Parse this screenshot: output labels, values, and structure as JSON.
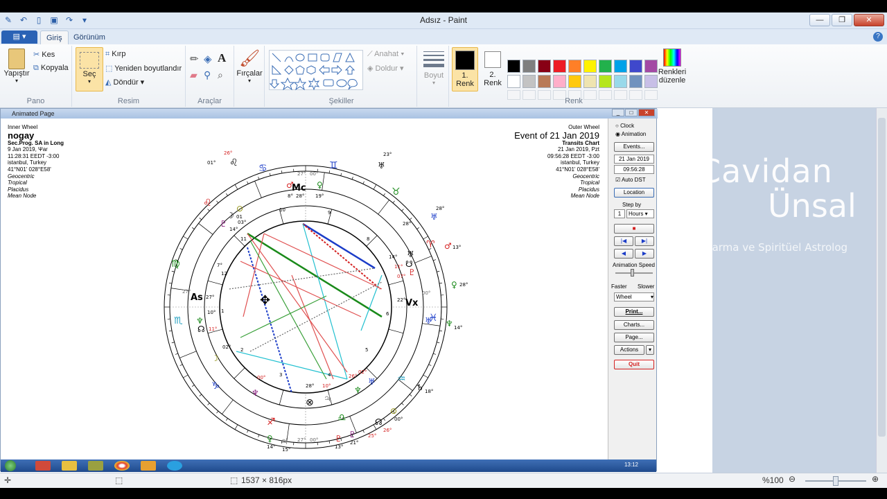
{
  "app": {
    "title": "Adsız - Paint"
  },
  "tabs": {
    "file": "▤ ▾",
    "home": "Giriş",
    "view": "Görünüm"
  },
  "ribbon": {
    "pano": {
      "label": "Pano",
      "paste": "Yapıştır",
      "cut": "Kes",
      "copy": "Kopyala"
    },
    "resim": {
      "label": "Resim",
      "select": "Seç",
      "crop": "Kırp",
      "resize": "Yeniden boyutlandır",
      "rotate": "Döndür"
    },
    "araclar": {
      "label": "Araçlar"
    },
    "brushes": {
      "label": "Fırçalar"
    },
    "sekiller": {
      "label": "Şekiller",
      "outline": "Anahat",
      "fill": "Doldur"
    },
    "size": {
      "label": "Boyut"
    },
    "renk": {
      "label": "Renk",
      "color1_line1": "1.",
      "color1_line2": "Renk",
      "color2_line1": "2.",
      "color2_line2": "Renk",
      "edit_line1": "Renkleri",
      "edit_line2": "düzenle"
    },
    "palette_row1": [
      "#000000",
      "#7f7f7f",
      "#880015",
      "#ed1c24",
      "#ff7f27",
      "#fff200",
      "#22b14c",
      "#00a2e8",
      "#3f48cc",
      "#a349a4"
    ],
    "palette_row2": [
      "#ffffff",
      "#c3c3c3",
      "#b97a57",
      "#ffaec9",
      "#ffc90e",
      "#efe4b0",
      "#b5e61d",
      "#99d9ea",
      "#7092be",
      "#c8bfe7"
    ]
  },
  "inner": {
    "title": "Animated Page",
    "left": {
      "wheel": "Inner Wheel",
      "name": "nogay",
      "subtitle": "Sec.Prog. SA in Long",
      "date": "9 Jan 2019, Ψar",
      "time": "11:28:31  EEDT -3:00",
      "place": "istanbul, Turkey",
      "coords": "41°N01' 028°E58'",
      "l1": "Geocentric",
      "l2": "Tropical",
      "l3": "Placidus",
      "l4": "Mean Node"
    },
    "right": {
      "wheel": "Outer Wheel",
      "event": "Event of 21 Jan 2019",
      "chart": "Transits Chart",
      "date": "21 Jan 2019, Pzt",
      "time": "09:56:28  EEDT -3:00",
      "place": "istanbul, Turkey",
      "coords": "41°N01' 028°E58'",
      "l1": "Geocentric",
      "l2": "Tropical",
      "l3": "Placidus",
      "l4": "Mean Node"
    },
    "panel": {
      "clock": "Clock",
      "animation": "Animation",
      "events": "Events...",
      "date": "21 Jan 2019",
      "time": "09:56:28",
      "auto_dst": "Auto DST",
      "location": "Location",
      "step_by": "Step by",
      "step_n": "1",
      "step_unit": "Hours",
      "anim_speed": "Animation Speed",
      "faster": "Faster",
      "slower": "Slower",
      "wheel": "Wheel",
      "print": "Print...",
      "charts": "Charts...",
      "page": "Page...",
      "actions": "Actions",
      "quit": "Quit"
    },
    "taskbar_time": "13:12"
  },
  "status": {
    "dimensions": "1537 × 816px",
    "zoom": "%100"
  },
  "watermark": {
    "line1": "Cavidan",
    "line2": "Ünsal",
    "line3": "Karma ve Spiritüel Astrolog"
  }
}
